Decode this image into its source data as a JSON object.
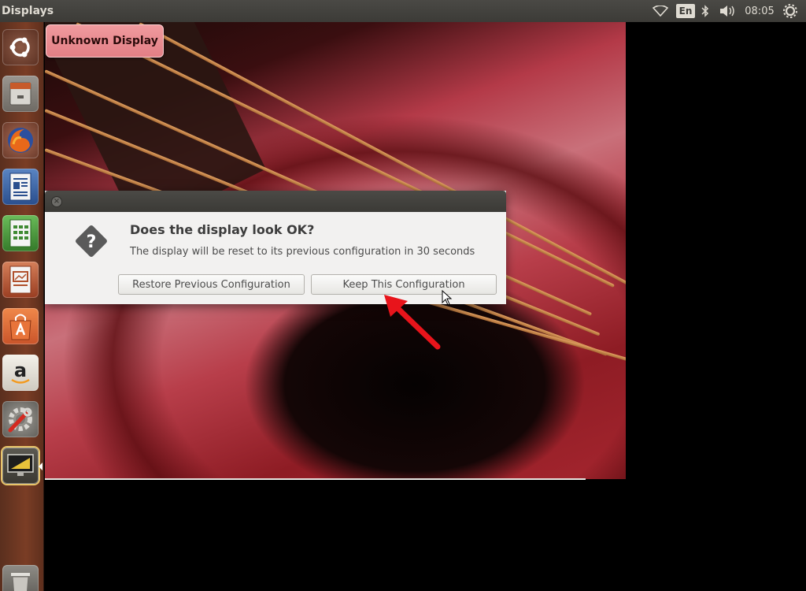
{
  "top_panel": {
    "title": "Displays",
    "language_label": "En",
    "clock": "08:05",
    "icons": [
      "wifi-icon",
      "keyboard-language-icon",
      "bluetooth-icon",
      "volume-icon",
      "session-gear-icon"
    ]
  },
  "launcher": {
    "items": [
      {
        "name": "ubuntu-dash",
        "icon": "ubuntu-logo-icon"
      },
      {
        "name": "files",
        "icon": "file-cabinet-icon"
      },
      {
        "name": "firefox",
        "icon": "firefox-icon"
      },
      {
        "name": "writer",
        "icon": "writer-document-icon"
      },
      {
        "name": "calc",
        "icon": "calc-spreadsheet-icon"
      },
      {
        "name": "impress",
        "icon": "impress-presentation-icon"
      },
      {
        "name": "software-center",
        "icon": "shopping-bag-icon"
      },
      {
        "name": "amazon",
        "icon": "amazon-icon"
      },
      {
        "name": "system-settings",
        "icon": "settings-wrench-icon"
      },
      {
        "name": "displays",
        "icon": "display-monitor-icon"
      },
      {
        "name": "trash",
        "icon": "trash-icon"
      }
    ]
  },
  "tooltip": {
    "label": "Unknown Display"
  },
  "dialog": {
    "heading": "Does the display look OK?",
    "message": "The display will be reset to its previous configuration in 30 seconds",
    "restore_label": "Restore Previous Configuration",
    "keep_label": "Keep This Configuration",
    "close_symbol": "×"
  },
  "colors": {
    "panel": "#3c3b37",
    "dialog_bg": "#f2f1f0",
    "tooltip": "#e98a90",
    "annotation_arrow": "#e8141b"
  }
}
